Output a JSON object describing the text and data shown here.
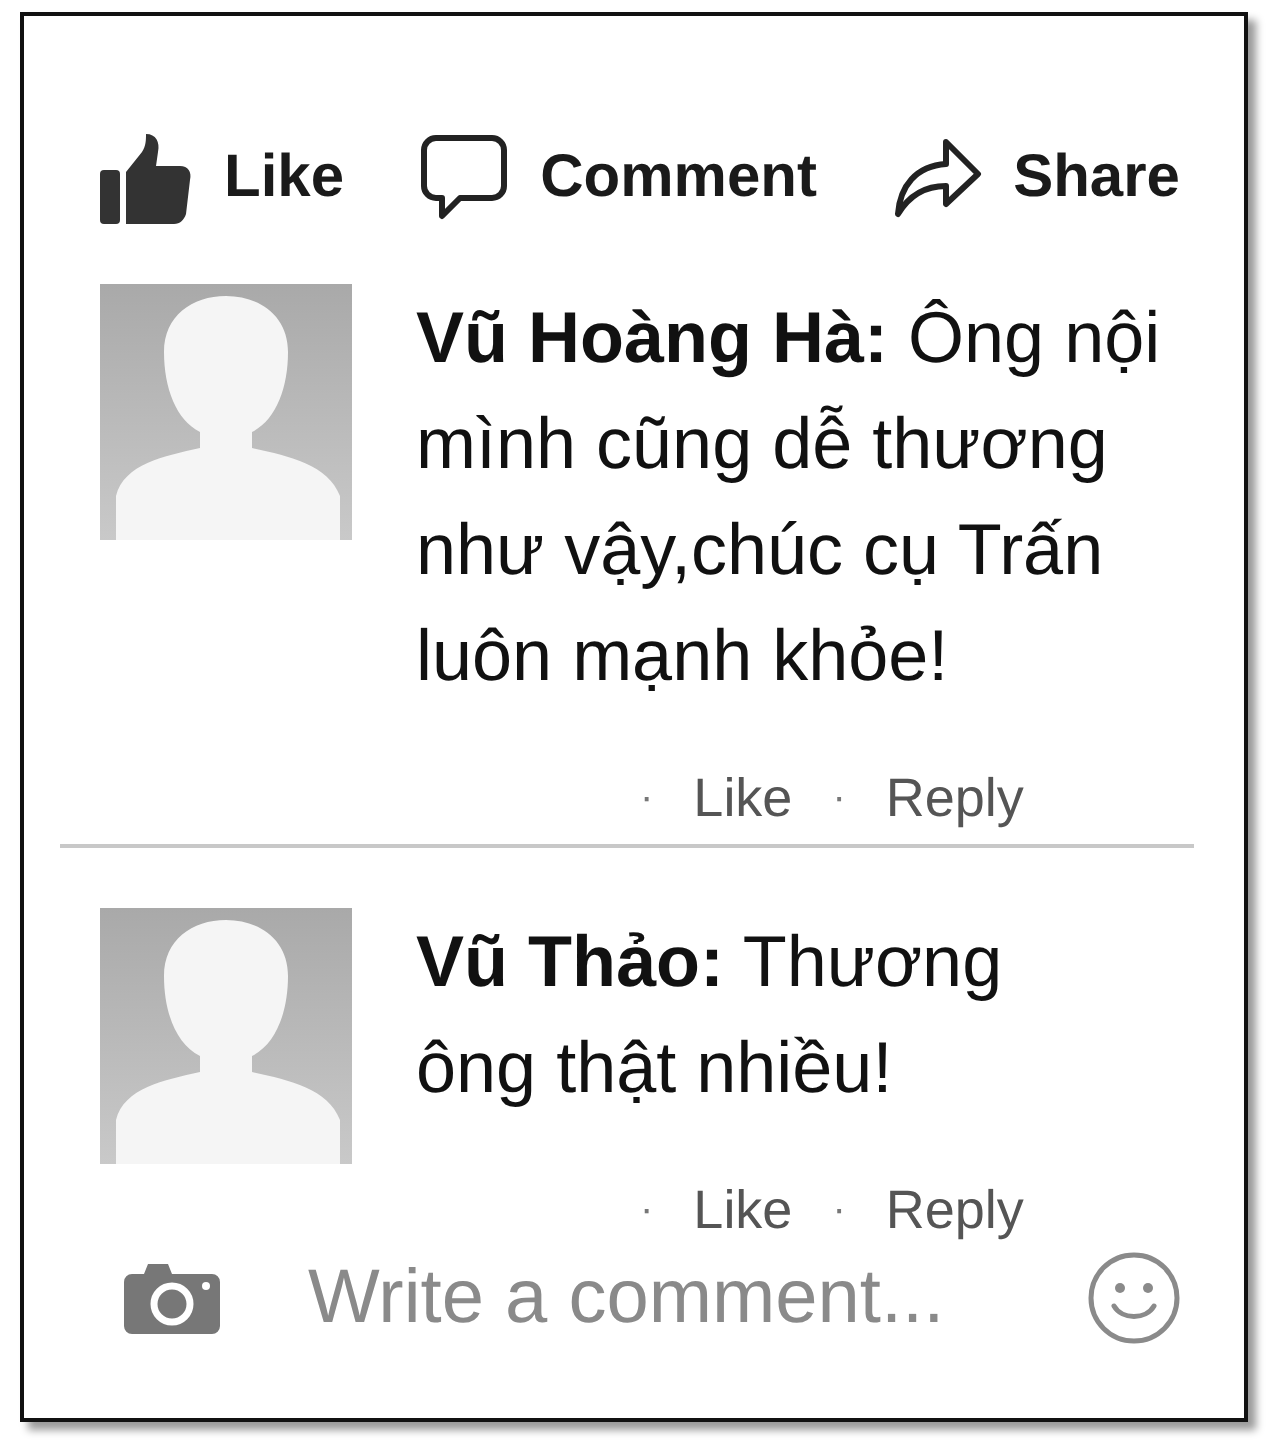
{
  "actions": [
    {
      "kind": "like",
      "label": "Like"
    },
    {
      "kind": "comment",
      "label": "Comment"
    },
    {
      "kind": "share",
      "label": "Share"
    }
  ],
  "comments": [
    {
      "text": "**Vũ Hoàng Hà:** Ông nội\nmình cũng dễ thương\nnhư vậy,chúc cụ Trấn\nluôn mạnh khỏe!",
      "links": [
        {
          "separator": "·",
          "label": "Like"
        },
        {
          "separator": "·",
          "label": "Reply"
        }
      ]
    },
    {
      "text": "**Vũ Thảo:** Thương\nông thật nhiều!",
      "links": [
        {
          "separator": "·",
          "label": "Like"
        },
        {
          "separator": "·",
          "label": "Reply"
        }
      ]
    }
  ],
  "composer": {
    "placeholder": "Write a comment..."
  }
}
